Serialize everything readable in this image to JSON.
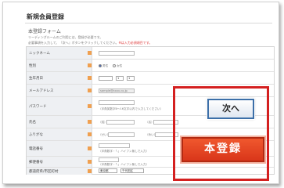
{
  "page": {
    "title": "新規会員登録"
  },
  "form": {
    "title": "本登録フォーム",
    "intro_line1": "リーディングルームのご利用には、登録が必要です。",
    "intro_line2": "必要事項を入力して、『次へ』ボタンをクリックしてください。",
    "intro_required_note": "※は入力必須項目です。",
    "rows": [
      {
        "label": "ニックネーム"
      },
      {
        "label": "性別",
        "options": [
          "男性",
          "女性"
        ]
      },
      {
        "label": "生年月日",
        "year": "",
        "month": "1",
        "day": "1"
      },
      {
        "label": "メールアドレス",
        "value": "sample@xxxx.co.jp"
      },
      {
        "label": "パスワード",
        "hint": "（半角英数字6〜16文字以内で入力してください）"
      },
      {
        "label": "氏名",
        "sei": "（姓）",
        "mei": "（名）"
      },
      {
        "label": "ふりがな",
        "sei": "（せい）",
        "mei": "（めい）"
      },
      {
        "label": "電話番号",
        "hint": "（半角数字・「-」ハイフン無しで入力）"
      },
      {
        "label": "郵便番号",
        "hint": "（半角数字・「-」ハイフン無しで入力）"
      },
      {
        "label": "都道府県/市区町村",
        "pref": "東京都",
        "city": "千代田区"
      }
    ]
  },
  "buttons": {
    "next": "次へ",
    "register": "本登録"
  },
  "colors": {
    "callout": "#d42020",
    "next_border": "#3c6fa8",
    "register_bg": "#e0401f",
    "required_marker": "#f0a050"
  }
}
